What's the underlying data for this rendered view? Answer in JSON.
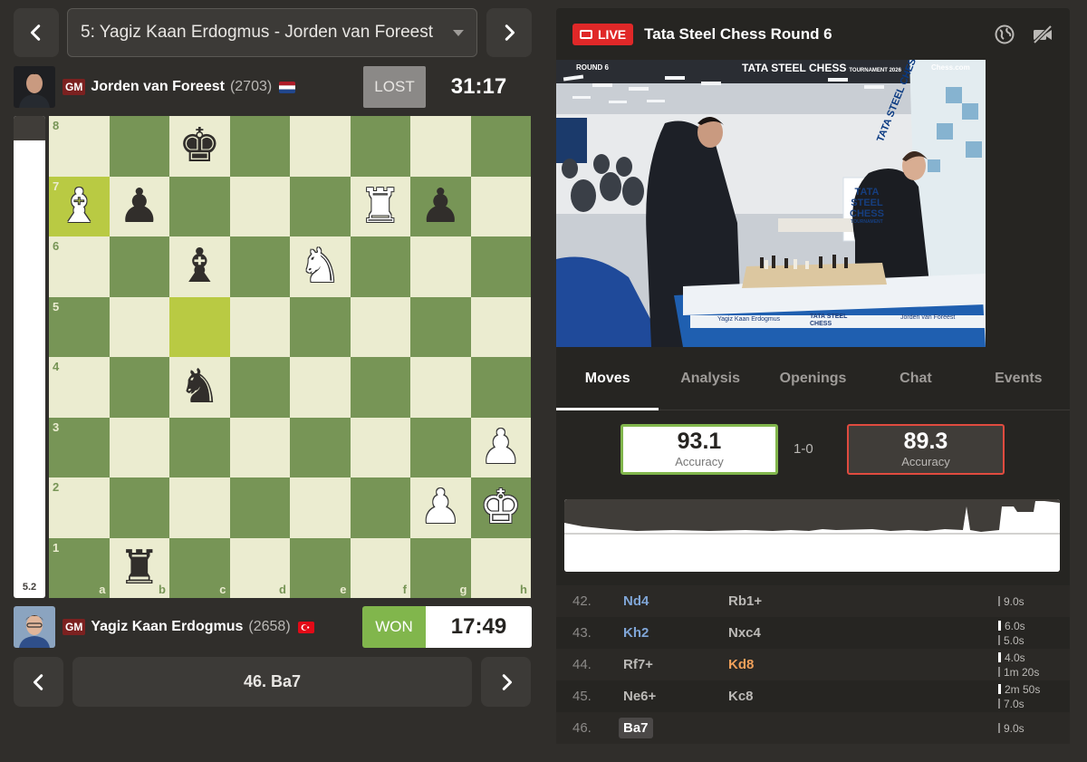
{
  "game_select": {
    "label": "5: Yagiz Kaan Erdogmus - Jorden van Foreest"
  },
  "top_player": {
    "title": "GM",
    "name": "Jorden van Foreest",
    "rating": "(2703)",
    "result": "LOST",
    "clock": "31:17",
    "flag": "Netherlands"
  },
  "bottom_player": {
    "title": "GM",
    "name": "Yagiz Kaan Erdogmus",
    "rating": "(2658)",
    "result": "WON",
    "clock": "17:49",
    "flag": "Turkey"
  },
  "eval": {
    "label": "5.2",
    "white_fraction": 0.95
  },
  "board": {
    "ranks": [
      "8",
      "7",
      "6",
      "5",
      "4",
      "3",
      "2",
      "1"
    ],
    "files": [
      "a",
      "b",
      "c",
      "d",
      "e",
      "f",
      "g",
      "h"
    ],
    "highlight": [
      "a7",
      "c5"
    ],
    "pieces": {
      "c8": "bk",
      "a7": "wb",
      "b7": "bp",
      "f7": "wr",
      "g7": "bp",
      "c6": "bb",
      "e6": "wn",
      "c4": "bn",
      "h3": "wp",
      "g2": "wp",
      "h2": "wk",
      "b1": "br"
    }
  },
  "current_move": "46. Ba7",
  "live": {
    "badge": "LIVE",
    "title": "Tata Steel Chess Round 6"
  },
  "video": {
    "round_label": "ROUND 6",
    "banner": "TATA STEEL CHESS",
    "banner_suffix": "TOURNAMENT 2026",
    "brand": "Chess.com",
    "standee": [
      "TATA",
      "STEEL",
      "CHESS",
      "TOURNAMENT"
    ],
    "table_left_name": "Yagiz Kaan Erdogmus",
    "table_right_name": "Jorden van Foreest",
    "table_center": [
      "TATA STEEL",
      "CHESS"
    ],
    "wall_text": "TATA STEEL CHESS"
  },
  "tabs": [
    "Moves",
    "Analysis",
    "Openings",
    "Chat",
    "Events"
  ],
  "accuracy": {
    "white": "93.1",
    "black": "89.3",
    "label": "Accuracy",
    "score": "1-0"
  },
  "moves": [
    {
      "num": "42.",
      "white": "Nd4",
      "black": "Rb1+",
      "times": [
        "9.0s"
      ]
    },
    {
      "num": "43.",
      "white": "Kh2",
      "black": "Nxc4",
      "times": [
        "6.0s",
        "5.0s"
      ]
    },
    {
      "num": "44.",
      "white": "Rf7+",
      "black": "Kd8",
      "times": [
        "4.0s",
        "1m 20s"
      ]
    },
    {
      "num": "45.",
      "white": "Ne6+",
      "black": "Kc8",
      "times": [
        "2m 50s",
        "7.0s"
      ]
    },
    {
      "num": "46.",
      "white": "Ba7",
      "black": "",
      "times": [
        "9.0s"
      ]
    }
  ],
  "colors": {
    "board_light": "#ebecd0",
    "board_dark": "#779556",
    "won": "#81b64c",
    "live": "#e02828"
  }
}
